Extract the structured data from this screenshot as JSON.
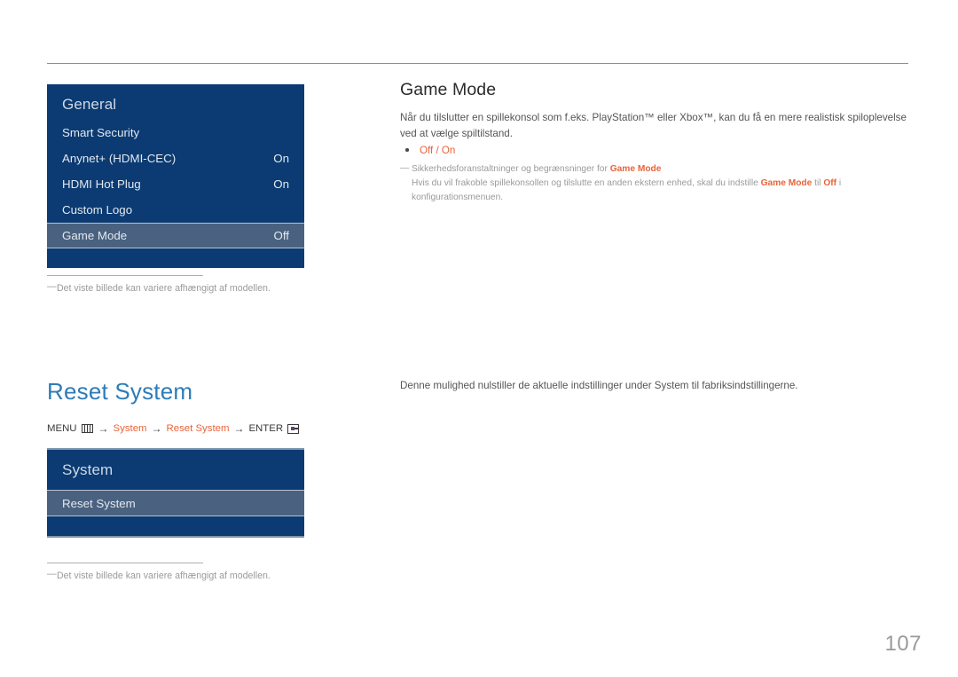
{
  "page": {
    "number": "107"
  },
  "osd_general": {
    "title": "General",
    "rows": [
      {
        "label": "Smart Security",
        "value": "",
        "selected": false
      },
      {
        "label": "Anynet+ (HDMI-CEC)",
        "value": "On",
        "selected": false
      },
      {
        "label": "HDMI Hot Plug",
        "value": "On",
        "selected": false
      },
      {
        "label": "Custom Logo",
        "value": "",
        "selected": false
      },
      {
        "label": "Game Mode",
        "value": "Off",
        "selected": true
      }
    ]
  },
  "osd_system": {
    "title": "System",
    "rows": [
      {
        "label": "Reset System",
        "value": "",
        "selected": true
      }
    ]
  },
  "footnotes": {
    "dash": "—",
    "caption_1": "Det viste billede kan variere afhængigt af modellen.",
    "caption_2": "Det viste billede kan variere afhængigt af modellen."
  },
  "section_game_mode": {
    "heading": "Game Mode",
    "body": "Når du tilslutter en spillekonsol som f.eks. PlayStation™ eller Xbox™, kan du få en mere realistisk spiloplevelse ved at vælge spiltilstand.",
    "bullet": "Off / On",
    "note_dash": "—",
    "note_line1_pre": "Sikkerhedsforanstaltninger og begrænsninger for ",
    "note_line1_em": "Game Mode",
    "note_line2_pre": "Hvis du vil frakoble spillekonsollen og tilslutte en anden ekstern enhed, skal du indstille ",
    "note_line2_em1": "Game Mode",
    "note_line2_mid": " til ",
    "note_line2_em2": "Off",
    "note_line2_post": " i konfigurationsmenuen."
  },
  "section_reset_system": {
    "heading": "Reset System",
    "body": "Denne mulighed nulstiller de aktuelle indstillinger under System til fabriksindstillingerne.",
    "path": {
      "menu_label": "MENU",
      "menu_icon": "menu-grid-icon",
      "arrow_1": "→",
      "step_1": "System",
      "arrow_2": "→",
      "step_2": "Reset System",
      "arrow_3": "→",
      "enter_label": "ENTER",
      "enter_icon": "enter-key-icon"
    }
  },
  "colors": {
    "osd_bg": "#0b3b72",
    "osd_selected": "#4a6280",
    "accent_orange": "#e8643c",
    "heading_blue": "#2d7cb8",
    "muted_grey": "#9a9a9a"
  }
}
